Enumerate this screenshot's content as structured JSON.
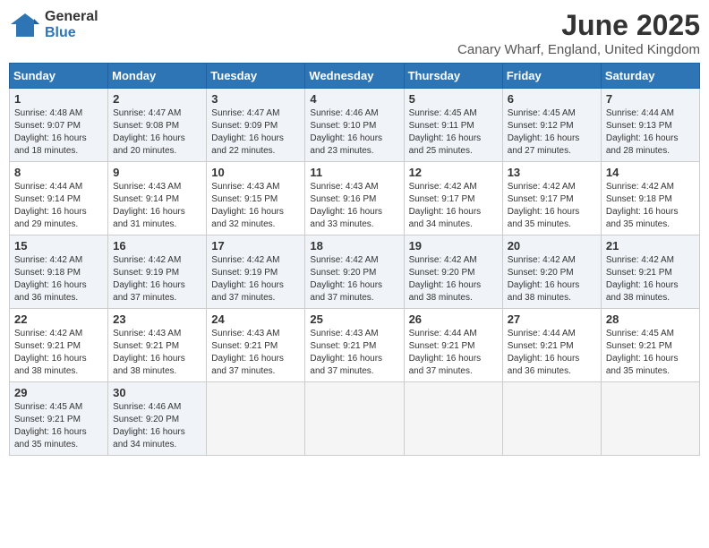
{
  "header": {
    "logo_general": "General",
    "logo_blue": "Blue",
    "month_title": "June 2025",
    "location": "Canary Wharf, England, United Kingdom"
  },
  "days_of_week": [
    "Sunday",
    "Monday",
    "Tuesday",
    "Wednesday",
    "Thursday",
    "Friday",
    "Saturday"
  ],
  "weeks": [
    [
      {
        "day": "1",
        "info": "Sunrise: 4:48 AM\nSunset: 9:07 PM\nDaylight: 16 hours\nand 18 minutes."
      },
      {
        "day": "2",
        "info": "Sunrise: 4:47 AM\nSunset: 9:08 PM\nDaylight: 16 hours\nand 20 minutes."
      },
      {
        "day": "3",
        "info": "Sunrise: 4:47 AM\nSunset: 9:09 PM\nDaylight: 16 hours\nand 22 minutes."
      },
      {
        "day": "4",
        "info": "Sunrise: 4:46 AM\nSunset: 9:10 PM\nDaylight: 16 hours\nand 23 minutes."
      },
      {
        "day": "5",
        "info": "Sunrise: 4:45 AM\nSunset: 9:11 PM\nDaylight: 16 hours\nand 25 minutes."
      },
      {
        "day": "6",
        "info": "Sunrise: 4:45 AM\nSunset: 9:12 PM\nDaylight: 16 hours\nand 27 minutes."
      },
      {
        "day": "7",
        "info": "Sunrise: 4:44 AM\nSunset: 9:13 PM\nDaylight: 16 hours\nand 28 minutes."
      }
    ],
    [
      {
        "day": "8",
        "info": "Sunrise: 4:44 AM\nSunset: 9:14 PM\nDaylight: 16 hours\nand 29 minutes."
      },
      {
        "day": "9",
        "info": "Sunrise: 4:43 AM\nSunset: 9:14 PM\nDaylight: 16 hours\nand 31 minutes."
      },
      {
        "day": "10",
        "info": "Sunrise: 4:43 AM\nSunset: 9:15 PM\nDaylight: 16 hours\nand 32 minutes."
      },
      {
        "day": "11",
        "info": "Sunrise: 4:43 AM\nSunset: 9:16 PM\nDaylight: 16 hours\nand 33 minutes."
      },
      {
        "day": "12",
        "info": "Sunrise: 4:42 AM\nSunset: 9:17 PM\nDaylight: 16 hours\nand 34 minutes."
      },
      {
        "day": "13",
        "info": "Sunrise: 4:42 AM\nSunset: 9:17 PM\nDaylight: 16 hours\nand 35 minutes."
      },
      {
        "day": "14",
        "info": "Sunrise: 4:42 AM\nSunset: 9:18 PM\nDaylight: 16 hours\nand 35 minutes."
      }
    ],
    [
      {
        "day": "15",
        "info": "Sunrise: 4:42 AM\nSunset: 9:18 PM\nDaylight: 16 hours\nand 36 minutes."
      },
      {
        "day": "16",
        "info": "Sunrise: 4:42 AM\nSunset: 9:19 PM\nDaylight: 16 hours\nand 37 minutes."
      },
      {
        "day": "17",
        "info": "Sunrise: 4:42 AM\nSunset: 9:19 PM\nDaylight: 16 hours\nand 37 minutes."
      },
      {
        "day": "18",
        "info": "Sunrise: 4:42 AM\nSunset: 9:20 PM\nDaylight: 16 hours\nand 37 minutes."
      },
      {
        "day": "19",
        "info": "Sunrise: 4:42 AM\nSunset: 9:20 PM\nDaylight: 16 hours\nand 38 minutes."
      },
      {
        "day": "20",
        "info": "Sunrise: 4:42 AM\nSunset: 9:20 PM\nDaylight: 16 hours\nand 38 minutes."
      },
      {
        "day": "21",
        "info": "Sunrise: 4:42 AM\nSunset: 9:21 PM\nDaylight: 16 hours\nand 38 minutes."
      }
    ],
    [
      {
        "day": "22",
        "info": "Sunrise: 4:42 AM\nSunset: 9:21 PM\nDaylight: 16 hours\nand 38 minutes."
      },
      {
        "day": "23",
        "info": "Sunrise: 4:43 AM\nSunset: 9:21 PM\nDaylight: 16 hours\nand 38 minutes."
      },
      {
        "day": "24",
        "info": "Sunrise: 4:43 AM\nSunset: 9:21 PM\nDaylight: 16 hours\nand 37 minutes."
      },
      {
        "day": "25",
        "info": "Sunrise: 4:43 AM\nSunset: 9:21 PM\nDaylight: 16 hours\nand 37 minutes."
      },
      {
        "day": "26",
        "info": "Sunrise: 4:44 AM\nSunset: 9:21 PM\nDaylight: 16 hours\nand 37 minutes."
      },
      {
        "day": "27",
        "info": "Sunrise: 4:44 AM\nSunset: 9:21 PM\nDaylight: 16 hours\nand 36 minutes."
      },
      {
        "day": "28",
        "info": "Sunrise: 4:45 AM\nSunset: 9:21 PM\nDaylight: 16 hours\nand 35 minutes."
      }
    ],
    [
      {
        "day": "29",
        "info": "Sunrise: 4:45 AM\nSunset: 9:21 PM\nDaylight: 16 hours\nand 35 minutes."
      },
      {
        "day": "30",
        "info": "Sunrise: 4:46 AM\nSunset: 9:20 PM\nDaylight: 16 hours\nand 34 minutes."
      },
      {
        "day": "",
        "info": ""
      },
      {
        "day": "",
        "info": ""
      },
      {
        "day": "",
        "info": ""
      },
      {
        "day": "",
        "info": ""
      },
      {
        "day": "",
        "info": ""
      }
    ]
  ]
}
